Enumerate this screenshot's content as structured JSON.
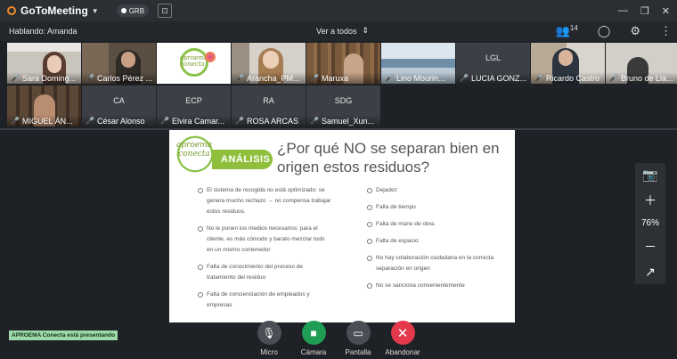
{
  "app": {
    "title": "GoToMeeting",
    "badge": "GRB"
  },
  "subheader": {
    "speaking": "Hablando: Amanda",
    "view_all": "Ver a todos",
    "attendee_count": "14"
  },
  "participants": [
    {
      "name": "Sara Doming...",
      "initials": "",
      "muted": true
    },
    {
      "name": "Carlos Pérez ...",
      "initials": "",
      "muted": true
    },
    {
      "name": "",
      "initials": "",
      "muted": false
    },
    {
      "name": "Arancha_PM...",
      "initials": "",
      "muted": true
    },
    {
      "name": "Maruxa",
      "initials": "",
      "muted": true
    },
    {
      "name": "Lino Mourin...",
      "initials": "",
      "muted": true
    },
    {
      "name": "LUCIA GONZ...",
      "initials": "LGL",
      "muted": true
    },
    {
      "name": "Ricardo Castro",
      "initials": "",
      "muted": true
    },
    {
      "name": "Bruno de Lla...",
      "initials": "",
      "muted": true
    },
    {
      "name": "MIGUEL ÁN...",
      "initials": "",
      "muted": true
    },
    {
      "name": "César Alonso",
      "initials": "CA",
      "muted": true
    },
    {
      "name": "Elvira Camar...",
      "initials": "ECP",
      "muted": true
    },
    {
      "name": "ROSA ARCAS",
      "initials": "RA",
      "muted": true
    },
    {
      "name": "Samuel_Xun...",
      "initials": "SDG",
      "muted": true
    }
  ],
  "slide": {
    "logo_text": "aproema conecta",
    "tag": "ANÁLISIS",
    "title": "¿Por qué NO se separan bien en origen estos residuos?",
    "left_bullets": [
      "El sistema de recogida no está optimizado: se genera mucho rechazo → no compensa trabajar estos residuos.",
      "No le ponen los medios necesarios: para el cliente, es más cómodo y barato mezclar todo en un mismo contenedor",
      "Falta de conocimiento del proceso de tratamiento del residuo",
      "Falta de concienciación de empleados y empresas"
    ],
    "right_bullets": [
      "Dejadez",
      "Falta de tiempo",
      "Falta de mano de obra",
      "Falta de espacio",
      "No hay colaboración ciudadana en la correcta separación en origen",
      "No se sanciona convenientemente"
    ]
  },
  "zoom": {
    "level": "76%"
  },
  "presenting_banner": "APROEMA Conecta está presentando",
  "controls": {
    "mic": "Micro",
    "camera": "Cámara",
    "screen": "Pantalla",
    "leave": "Abandonar"
  },
  "colors": {
    "leave": "#e3394b",
    "camera": "#1f9d55",
    "neutral": "#4a4e55",
    "accent": "#8fbf3c"
  }
}
